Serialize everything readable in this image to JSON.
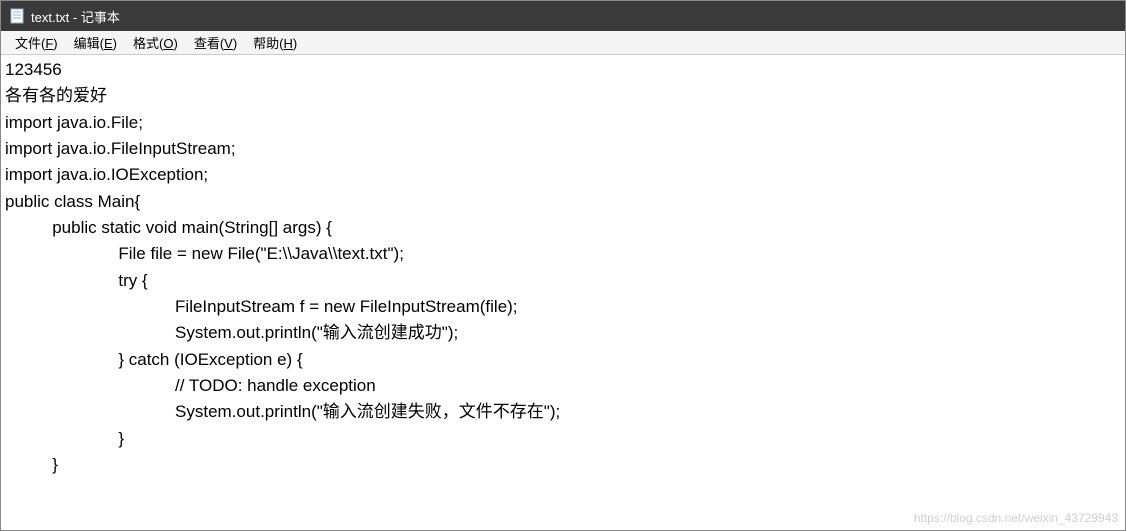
{
  "titlebar": {
    "title": "text.txt - 记事本"
  },
  "menu": {
    "file": "文件(F)",
    "edit": "编辑(E)",
    "format": "格式(O)",
    "view": "查看(V)",
    "help": "帮助(H)"
  },
  "editor": {
    "content": "123456\n各有各的爱好\nimport java.io.File;\nimport java.io.FileInputStream;\nimport java.io.IOException;\npublic class Main{\n          public static void main(String[] args) {\n                        File file = new File(\"E:\\\\Java\\\\text.txt\");\n                        try {\n                                    FileInputStream f = new FileInputStream(file);\n                                    System.out.println(\"输入流创建成功\");\n                        } catch (IOException e) {\n                                    // TODO: handle exception\n                                    System.out.println(\"输入流创建失败，文件不存在\");\n                        }\n          }"
  },
  "watermark": {
    "text": "https://blog.csdn.net/weixin_43729943"
  }
}
